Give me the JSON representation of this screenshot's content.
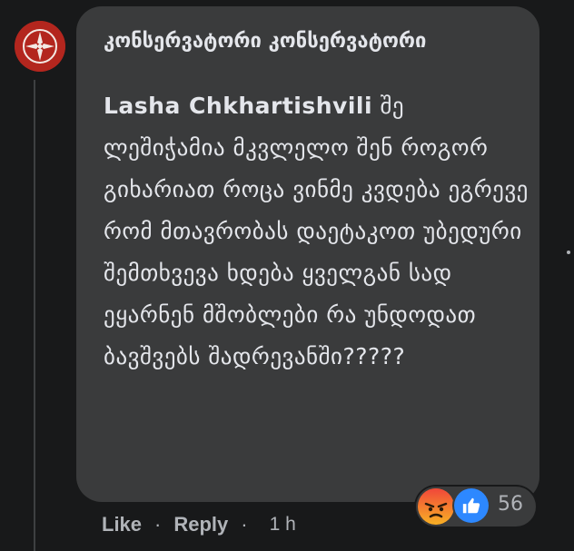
{
  "comment": {
    "author": "კონსერვატორი კონსერვატორი",
    "mention": "Lasha Chkhartishvili",
    "text": " შე ლეშიჭამია მკვლელო შენ როგორ გიხარიათ როცა ვინმე კვდება ეგრევე რომ მთავრობას დაეტაკოთ უბედური შემთხვევა ხდება ყველგან სად ეყარნენ მშობლები რა უნდოდათ ბავშვებს შადრევანში?????"
  },
  "reactions": {
    "types": [
      "angry-icon",
      "like-icon"
    ],
    "count": "56"
  },
  "actions": {
    "like_label": "Like",
    "reply_label": "Reply",
    "time": "1 h"
  },
  "colors": {
    "background": "#18191a",
    "bubble": "#3a3b3c",
    "text": "#e4e6eb",
    "secondary_text": "#b0b3b8",
    "avatar": "#b3261e",
    "like_blue": "#2d88ff",
    "angry_orange": "#e9710f"
  }
}
